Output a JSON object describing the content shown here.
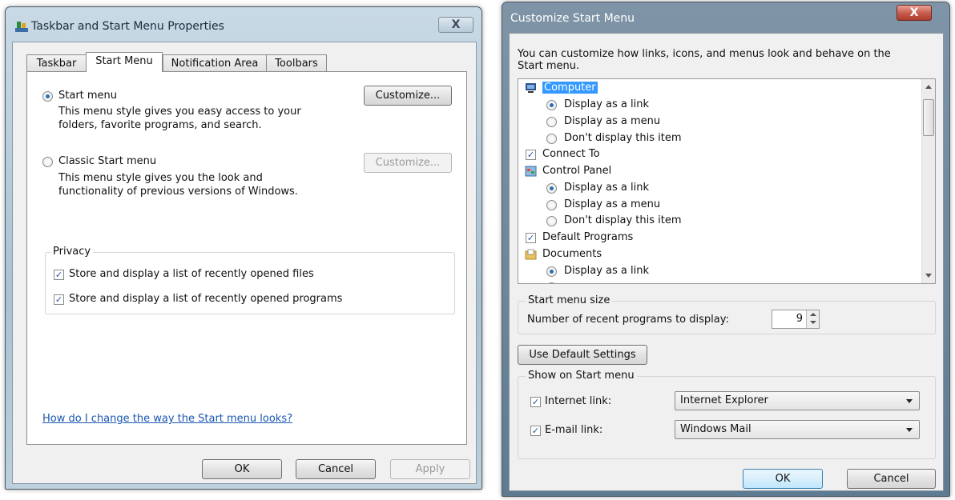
{
  "taskbar_dialog": {
    "title": "Taskbar and Start Menu Properties",
    "tabs": [
      "Taskbar",
      "Start Menu",
      "Notification Area",
      "Toolbars"
    ],
    "start_menu_option": {
      "label": "Start menu",
      "desc1": "This menu style gives you easy access to your",
      "desc2": "folders, favorite programs, and search.",
      "button": "Customize..."
    },
    "classic_option": {
      "label": "Classic Start menu",
      "desc1": "This menu style gives you the look and",
      "desc2": "functionality of previous versions of Windows.",
      "button": "Customize..."
    },
    "privacy": {
      "title": "Privacy",
      "files": "Store and display a list of recently opened files",
      "programs": "Store and display a list of recently opened programs"
    },
    "help_link": "How do I change the way the Start menu looks?",
    "buttons": {
      "ok": "OK",
      "cancel": "Cancel",
      "apply": "Apply"
    }
  },
  "customize_dialog": {
    "title": "Customize Start Menu",
    "intro1": "You can customize how links, icons, and menus look and behave on the",
    "intro2": "Start menu.",
    "list": {
      "computer": "Computer",
      "display_link": "Display as a link",
      "display_menu": "Display as a menu",
      "dont_display": "Don't display this item",
      "connect_to": "Connect To",
      "control_panel": "Control Panel",
      "default_programs": "Default Programs",
      "documents": "Documents"
    },
    "size": {
      "title": "Start menu size",
      "label": "Number of recent programs to display:",
      "value": "9"
    },
    "use_default": "Use Default Settings",
    "show": {
      "title": "Show on Start menu",
      "internet_label": "Internet link:",
      "internet_value": "Internet Explorer",
      "email_label": "E-mail link:",
      "email_value": "Windows Mail"
    },
    "buttons": {
      "ok": "OK",
      "cancel": "Cancel"
    }
  },
  "close_glyph": "X",
  "colors": {
    "link": "#1a56b0",
    "close_inactive": "#c6d5e2",
    "close_active": "#c45a4a",
    "selection": "#3399ff"
  }
}
